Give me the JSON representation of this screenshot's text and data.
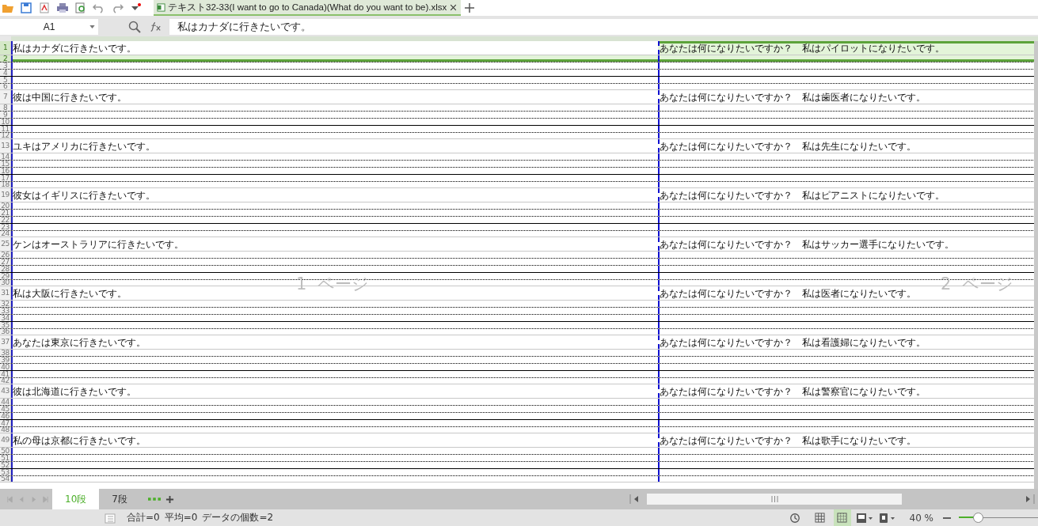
{
  "toolbar": {
    "file_tab": {
      "title": "テキスト32-33(I want to go to Canada)(What do you want to be).xlsx",
      "selected": true
    }
  },
  "formula_bar": {
    "cell_ref": "A1",
    "formula": "私はカナダに行きたいです。"
  },
  "sheet": {
    "page_labels": [
      "1  ページ",
      "2  ページ"
    ],
    "rows": [
      {
        "number": "1",
        "kind": "text",
        "selected": true,
        "cells": [
          "私はカナダに行きたいです。",
          "あなたは何になりたいですか？　私はパイロットになりたいです。"
        ]
      },
      {
        "number": "2",
        "kind": "dotted",
        "selected": true
      },
      {
        "number": "3",
        "kind": "dotted",
        "selected": false
      },
      {
        "number": "4",
        "kind": "solid",
        "selected": false
      },
      {
        "number": "5",
        "kind": "dotted",
        "selected": false
      },
      {
        "number": "6",
        "kind": "blank",
        "selected": false
      },
      {
        "number": "7",
        "kind": "text",
        "selected": false,
        "cells": [
          "彼は中国に行きたいです。",
          "あなたは何になりたいですか？　私は歯医者になりたいです。"
        ]
      },
      {
        "number": "8",
        "kind": "dotted",
        "selected": false
      },
      {
        "number": "9",
        "kind": "dotted",
        "selected": false
      },
      {
        "number": "10",
        "kind": "solid",
        "selected": false
      },
      {
        "number": "11",
        "kind": "dotted",
        "selected": false
      },
      {
        "number": "12",
        "kind": "blank",
        "selected": false
      },
      {
        "number": "13",
        "kind": "text",
        "selected": false,
        "cells": [
          "ユキはアメリカに行きたいです。",
          "あなたは何になりたいですか？　私は先生になりたいです。"
        ]
      },
      {
        "number": "14",
        "kind": "dotted",
        "selected": false
      },
      {
        "number": "15",
        "kind": "dotted",
        "selected": false
      },
      {
        "number": "16",
        "kind": "solid",
        "selected": false
      },
      {
        "number": "17",
        "kind": "dotted",
        "selected": false
      },
      {
        "number": "18",
        "kind": "blank",
        "selected": false
      },
      {
        "number": "19",
        "kind": "text",
        "selected": false,
        "cells": [
          "彼女はイギリスに行きたいです。",
          "あなたは何になりたいですか？　私はピアニストになりたいです。"
        ]
      },
      {
        "number": "20",
        "kind": "dotted",
        "selected": false
      },
      {
        "number": "21",
        "kind": "dotted",
        "selected": false
      },
      {
        "number": "22",
        "kind": "solid",
        "selected": false
      },
      {
        "number": "23",
        "kind": "dotted",
        "selected": false
      },
      {
        "number": "24",
        "kind": "blank",
        "selected": false
      },
      {
        "number": "25",
        "kind": "text",
        "selected": false,
        "cells": [
          "ケンはオーストラリアに行きたいです。",
          "あなたは何になりたいですか？　私はサッカー選手になりたいです。"
        ]
      },
      {
        "number": "26",
        "kind": "dotted",
        "selected": false
      },
      {
        "number": "27",
        "kind": "dotted",
        "selected": false
      },
      {
        "number": "28",
        "kind": "solid",
        "selected": false
      },
      {
        "number": "29",
        "kind": "dotted",
        "selected": false
      },
      {
        "number": "30",
        "kind": "blank",
        "selected": false
      },
      {
        "number": "31",
        "kind": "text",
        "selected": false,
        "cells": [
          "私は大阪に行きたいです。",
          "あなたは何になりたいですか？　私は医者になりたいです。"
        ]
      },
      {
        "number": "32",
        "kind": "dotted",
        "selected": false
      },
      {
        "number": "33",
        "kind": "dotted",
        "selected": false
      },
      {
        "number": "34",
        "kind": "solid",
        "selected": false
      },
      {
        "number": "35",
        "kind": "dotted",
        "selected": false
      },
      {
        "number": "36",
        "kind": "blank",
        "selected": false
      },
      {
        "number": "37",
        "kind": "text",
        "selected": false,
        "cells": [
          "あなたは東京に行きたいです。",
          "あなたは何になりたいですか？　私は看護婦になりたいです。"
        ]
      },
      {
        "number": "38",
        "kind": "dotted",
        "selected": false
      },
      {
        "number": "39",
        "kind": "dotted",
        "selected": false
      },
      {
        "number": "40",
        "kind": "solid",
        "selected": false
      },
      {
        "number": "41",
        "kind": "dotted",
        "selected": false
      },
      {
        "number": "42",
        "kind": "blank",
        "selected": false
      },
      {
        "number": "43",
        "kind": "text",
        "selected": false,
        "cells": [
          "彼は北海道に行きたいです。",
          "あなたは何になりたいですか？　私は警察官になりたいです。"
        ]
      },
      {
        "number": "44",
        "kind": "dotted",
        "selected": false
      },
      {
        "number": "45",
        "kind": "dotted",
        "selected": false
      },
      {
        "number": "46",
        "kind": "solid",
        "selected": false
      },
      {
        "number": "47",
        "kind": "dotted",
        "selected": false
      },
      {
        "number": "48",
        "kind": "blank",
        "selected": false
      },
      {
        "number": "49",
        "kind": "text",
        "selected": false,
        "cells": [
          "私の母は京都に行きたいです。",
          "あなたは何になりたいですか？　私は歌手になりたいです。"
        ]
      },
      {
        "number": "50",
        "kind": "dotted",
        "selected": false
      },
      {
        "number": "51",
        "kind": "dotted",
        "selected": false
      },
      {
        "number": "52",
        "kind": "solid",
        "selected": false
      },
      {
        "number": "53",
        "kind": "dotted",
        "selected": false
      },
      {
        "number": "54",
        "kind": "blank",
        "selected": false
      }
    ]
  },
  "sheet_tabs": [
    {
      "label": "10段",
      "selected": true
    },
    {
      "label": "7段",
      "selected": false
    }
  ],
  "status_bar": {
    "sum": "合計=0",
    "average": "平均=0",
    "count": "データの個数=2",
    "views": [
      {
        "selected": false
      },
      {
        "selected": true
      }
    ],
    "zoom": "40 %",
    "zoom_slider": {
      "level": 0.25
    }
  }
}
